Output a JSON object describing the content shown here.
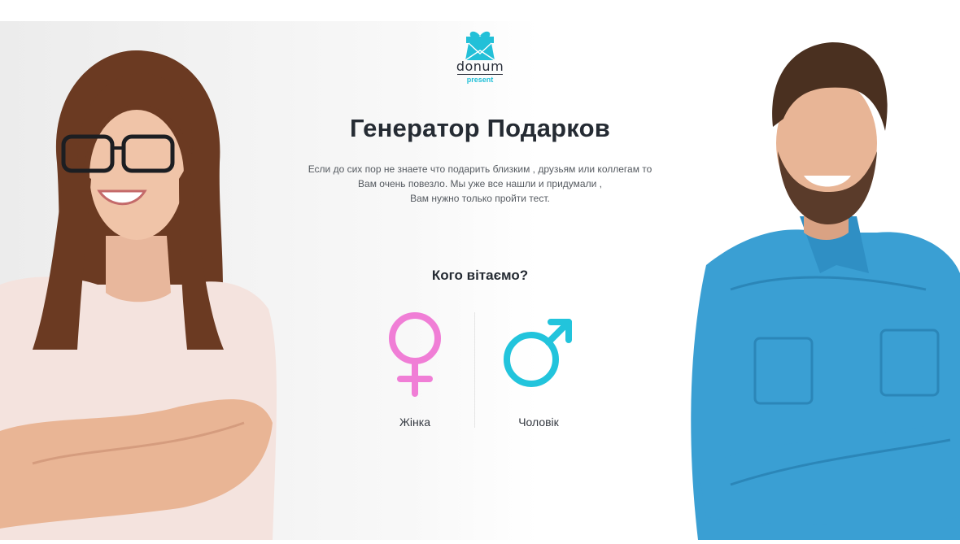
{
  "brand": {
    "name": "donum",
    "sub": "present",
    "accent_color": "#22c0d8"
  },
  "hero": {
    "title": "Генератор Подарков",
    "description_lines": [
      "Если до сих пор не знаете что подарить близким , друзьям или коллегам то",
      "Вам очень повезло. Мы уже все нашли и придумали ,",
      "Вам нужно только пройти тест."
    ]
  },
  "gender_select": {
    "question": "Кого вітаємо?",
    "options": [
      {
        "label": "Жінка",
        "icon": "female-symbol-icon",
        "color": "#f07ed6"
      },
      {
        "label": "Чоловік",
        "icon": "male-symbol-icon",
        "color": "#22c4dc"
      }
    ]
  },
  "photos": {
    "left": "woman-photo",
    "right": "man-photo"
  }
}
